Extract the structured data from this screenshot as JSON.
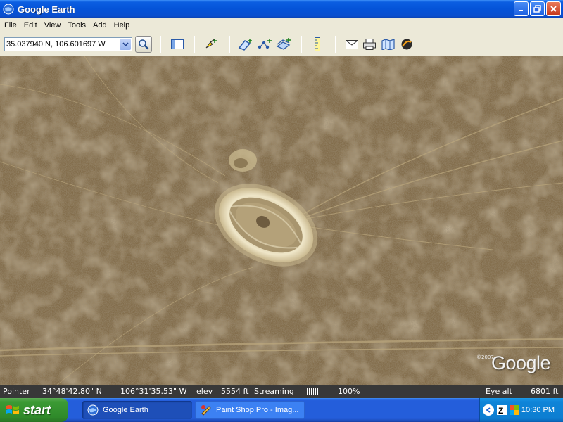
{
  "window": {
    "title": "Google Earth"
  },
  "menu": {
    "items": [
      "File",
      "Edit",
      "View",
      "Tools",
      "Add",
      "Help"
    ]
  },
  "toolbar": {
    "search_value": "35.037940 N, 106.601697 W",
    "icons": [
      "search-go-icon",
      "sidebar-toggle-icon",
      "placemark-icon",
      "polygon-icon",
      "path-icon",
      "image-overlay-icon",
      "ruler-icon",
      "email-icon",
      "print-icon",
      "maps-icon",
      "sky-icon"
    ]
  },
  "map": {
    "copyright": "©2007",
    "logo_text": "Google"
  },
  "status": {
    "pointer_label": "Pointer",
    "lat": "34°48'42.80\" N",
    "lon": "106°31'35.53\" W",
    "elev_label": "elev",
    "elev": "5554 ft",
    "streaming_label": "Streaming",
    "streaming_percent": "100%",
    "eye_alt_label": "Eye alt",
    "eye_alt": "6801 ft"
  },
  "taskbar": {
    "start_label": "start",
    "tasks": [
      "Google Earth",
      "Paint Shop Pro - Imag..."
    ],
    "clock": "10:30 PM"
  },
  "colors": {
    "title_blue": "#0553d8",
    "start_green": "#3c9a34",
    "terrain_brown": "#7f6a48"
  }
}
